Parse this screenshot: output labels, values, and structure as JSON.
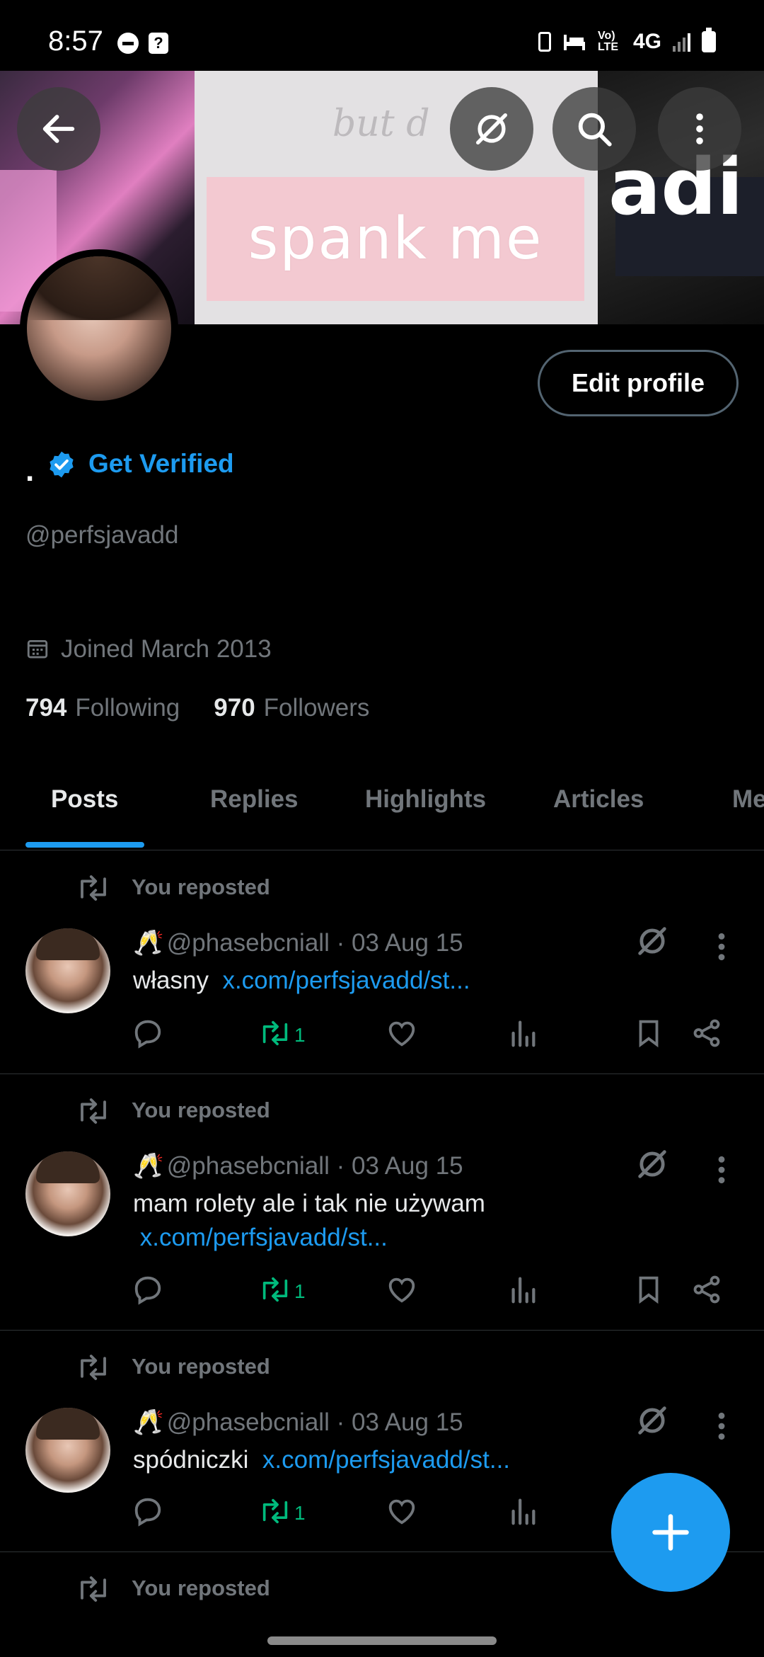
{
  "status_bar": {
    "time": "8:57",
    "network": "4G",
    "volte": "Vo) LTE"
  },
  "banner": {
    "text": "spank me",
    "faint_text": "but d",
    "right_text": "adi"
  },
  "profile": {
    "display_name": ".",
    "get_verified": "Get Verified",
    "handle": "@perfsjavadd",
    "joined": "Joined March 2013",
    "following_count": "794",
    "following_label": "Following",
    "followers_count": "970",
    "followers_label": "Followers",
    "edit_button": "Edit profile"
  },
  "tabs": [
    {
      "label": "Posts",
      "active": true
    },
    {
      "label": "Replies",
      "active": false
    },
    {
      "label": "Highlights",
      "active": false
    },
    {
      "label": "Articles",
      "active": false
    },
    {
      "label": "Me",
      "active": false
    }
  ],
  "posts": [
    {
      "repost_label": "You reposted",
      "emoji": "🥂",
      "handle": "@phasebcniall",
      "sep": "·",
      "date": "03 Aug 15",
      "text": "własny",
      "link": "x.com/perfsjavadd/st...",
      "retweets": "1"
    },
    {
      "repost_label": "You reposted",
      "emoji": "🥂",
      "handle": "@phasebcniall",
      "sep": "·",
      "date": "03 Aug 15",
      "text": "mam rolety ale i tak nie używam",
      "link": "x.com/perfsjavadd/st...",
      "retweets": "1"
    },
    {
      "repost_label": "You reposted",
      "emoji": "🥂",
      "handle": "@phasebcniall",
      "sep": "·",
      "date": "03 Aug 15",
      "text": "spódniczki",
      "link": "x.com/perfsjavadd/st...",
      "retweets": "1"
    },
    {
      "repost_label": "You reposted"
    }
  ],
  "colors": {
    "accent": "#1d9bf0",
    "retweet_green": "#00ba7c",
    "muted": "#71767b",
    "background": "#000000"
  }
}
